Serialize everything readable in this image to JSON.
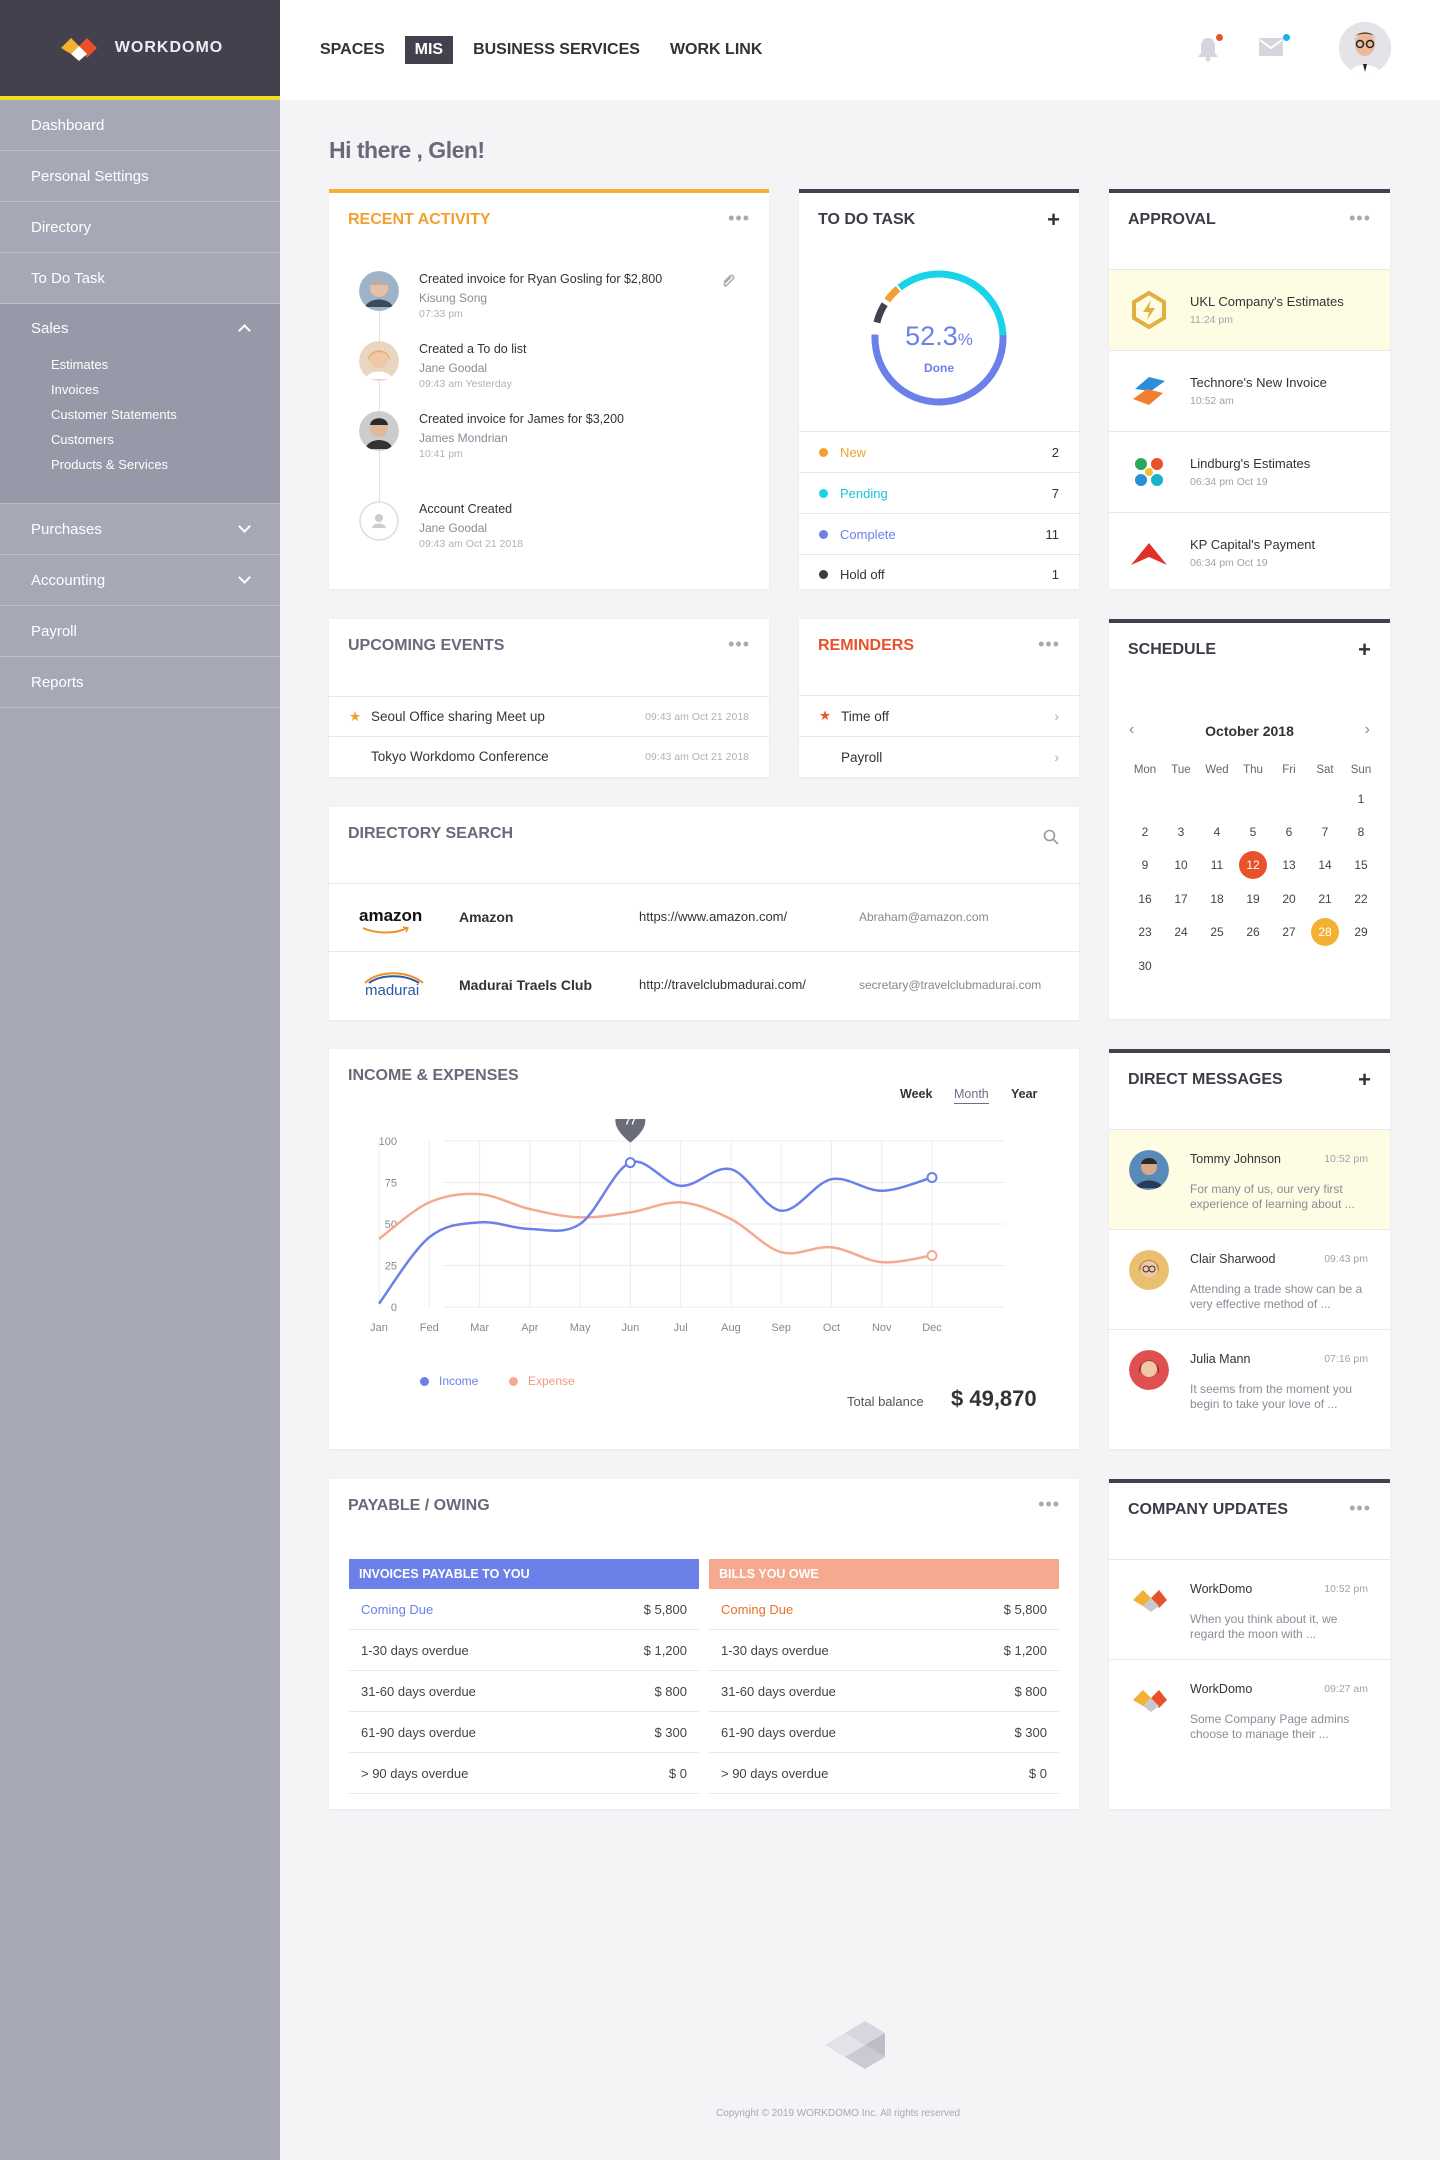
{
  "app": {
    "brand": "WORKDOMO"
  },
  "sidebar": {
    "items": [
      {
        "label": "Dashboard"
      },
      {
        "label": "Personal Settings"
      },
      {
        "label": "Directory"
      },
      {
        "label": "To Do Task"
      },
      {
        "label": "Sales"
      },
      {
        "label": "Purchases"
      },
      {
        "label": "Accounting"
      },
      {
        "label": "Payroll"
      },
      {
        "label": "Reports"
      }
    ],
    "sales_sub": [
      "Estimates",
      "Invoices",
      "Customer Statements",
      "Customers",
      "Products & Services"
    ]
  },
  "topnav": {
    "items": [
      "SPACES",
      "MIS",
      "BUSINESS SERVICES",
      "WORK LINK"
    ],
    "active": "MIS"
  },
  "greeting": "Hi there , Glen!",
  "recent_activity": {
    "title": "RECENT ACTIVITY",
    "items": [
      {
        "title": "Created invoice for Ryan Gosling for $2,800",
        "user": "Kisung Song",
        "time": "07:33 pm"
      },
      {
        "title": "Created a To do list",
        "user": "Jane Goodal",
        "time": "09:43 am Yesterday"
      },
      {
        "title": "Created invoice for James for $3,200",
        "user": "James Mondrian",
        "time": "10:41 pm"
      },
      {
        "title": "Account Created",
        "user": "Jane Goodal",
        "time": "09:43 am  Oct 21 2018"
      }
    ]
  },
  "todo": {
    "title": "TO DO TASK",
    "percent": "52.3",
    "percent_sign": "%",
    "done_label": "Done",
    "rows": [
      {
        "label": "New",
        "count": "2",
        "color": "#f0a030"
      },
      {
        "label": "Pending",
        "count": "7",
        "color": "#19d3e8"
      },
      {
        "label": "Complete",
        "count": "11",
        "color": "#6b80e8"
      },
      {
        "label": "Hold off",
        "count": "1",
        "color": "#3c3c46"
      }
    ]
  },
  "approval": {
    "title": "APPROVAL",
    "items": [
      {
        "name": "UKL Company's Estimates",
        "time": "11:24 pm"
      },
      {
        "name": "Technore's New Invoice",
        "time": "10:52 am"
      },
      {
        "name": "Lindburg's Estimates",
        "time": "06:34 pm  Oct 19"
      },
      {
        "name": "KP Capital's Payment",
        "time": "06:34 pm  Oct 19"
      }
    ]
  },
  "events": {
    "title": "UPCOMING EVENTS",
    "items": [
      {
        "name": "Seoul Office sharing Meet up",
        "time": "09:43 am  Oct 21 2018"
      },
      {
        "name": "Tokyo Workdomo Conference",
        "time": "09:43 am  Oct 21 2018"
      }
    ]
  },
  "reminders": {
    "title": "REMINDERS",
    "items": [
      "Time off",
      "Payroll"
    ]
  },
  "schedule": {
    "title": "SCHEDULE",
    "month": "October 2018",
    "days": [
      "Mon",
      "Tue",
      "Wed",
      "Thu",
      "Fri",
      "Sat",
      "Sun"
    ],
    "dates": [
      "",
      "",
      "",
      "",
      "",
      "",
      "1",
      "2",
      "3",
      "4",
      "5",
      "6",
      "7",
      "8",
      "9",
      "10",
      "11",
      "12",
      "13",
      "14",
      "15",
      "16",
      "17",
      "18",
      "19",
      "20",
      "21",
      "22",
      "23",
      "24",
      "25",
      "26",
      "27",
      "28",
      "29",
      "30"
    ],
    "highlight_red": "12",
    "highlight_orange": "28"
  },
  "directory": {
    "title": "DIRECTORY SEARCH",
    "rows": [
      {
        "logo": "amazon",
        "name": "Amazon",
        "url": "https://www.amazon.com/",
        "email": "Abraham@amazon.com"
      },
      {
        "logo": "madurai",
        "name": "Madurai Traels Club",
        "url": "http://travelclubmadurai.com/",
        "email": "secretary@travelclubmadurai.com"
      }
    ]
  },
  "income": {
    "title": "INCOME & EXPENSES",
    "tabs": [
      "Week",
      "Month",
      "Year"
    ],
    "active_tab": "Month",
    "marker": "77",
    "total_label": "Total balance",
    "total_value": "$ 49,870"
  },
  "chart_data": {
    "type": "line",
    "categories": [
      "Jan",
      "Fed",
      "Mar",
      "Apr",
      "May",
      "Jun",
      "Jul",
      "Aug",
      "Sep",
      "Oct",
      "Nov",
      "Dec"
    ],
    "yticks": [
      0,
      25,
      50,
      75,
      100
    ],
    "ylim": [
      0,
      100
    ],
    "series": [
      {
        "name": "Income",
        "color": "#6b80e8",
        "values": [
          2,
          42,
          51,
          47,
          50,
          87,
          73,
          83,
          58,
          77,
          70,
          78
        ]
      },
      {
        "name": "Expense",
        "color": "#f5a98f",
        "values": [
          41,
          63,
          68,
          59,
          54,
          57,
          63,
          53,
          33,
          36,
          27,
          31
        ]
      }
    ]
  },
  "messages": {
    "title": "DIRECT MESSAGES",
    "items": [
      {
        "name": "Tommy Johnson",
        "time": "10:52 pm",
        "text": "For many of us, our very first experience of learning about ..."
      },
      {
        "name": "Clair Sharwood",
        "time": "09:43 pm",
        "text": "Attending a trade show can be a very effective method of ..."
      },
      {
        "name": "Julia Mann",
        "time": "07:16 pm",
        "text": "It seems from the moment you begin to take your love of ..."
      }
    ]
  },
  "payable": {
    "title": "PAYABLE / OWING",
    "left_head": "INVOICES PAYABLE TO YOU",
    "right_head": "BILLS YOU OWE",
    "left": [
      {
        "label": "Coming Due",
        "value": "$ 5,800"
      },
      {
        "label": "1-30 days overdue",
        "value": "$ 1,200"
      },
      {
        "label": "31-60 days overdue",
        "value": "$ 800"
      },
      {
        "label": "61-90 days overdue",
        "value": "$ 300"
      },
      {
        "label": "> 90 days overdue",
        "value": "$ 0"
      }
    ],
    "right": [
      {
        "label": "Coming Due",
        "value": "$ 5,800"
      },
      {
        "label": "1-30 days overdue",
        "value": "$ 1,200"
      },
      {
        "label": "31-60 days overdue",
        "value": "$ 800"
      },
      {
        "label": "61-90 days overdue",
        "value": "$ 300"
      },
      {
        "label": "> 90 days overdue",
        "value": "$ 0"
      }
    ]
  },
  "updates": {
    "title": "COMPANY UPDATES",
    "items": [
      {
        "name": "WorkDomo",
        "time": "10:52 pm",
        "text": "When you think about it, we regard the moon with ..."
      },
      {
        "name": "WorkDomo",
        "time": "09:27 am",
        "text": "Some Company Page admins choose to manage their ..."
      }
    ]
  },
  "footer": {
    "copyright": "Copyright © 2019   WORKDOMO Inc.   All rights reserved"
  }
}
